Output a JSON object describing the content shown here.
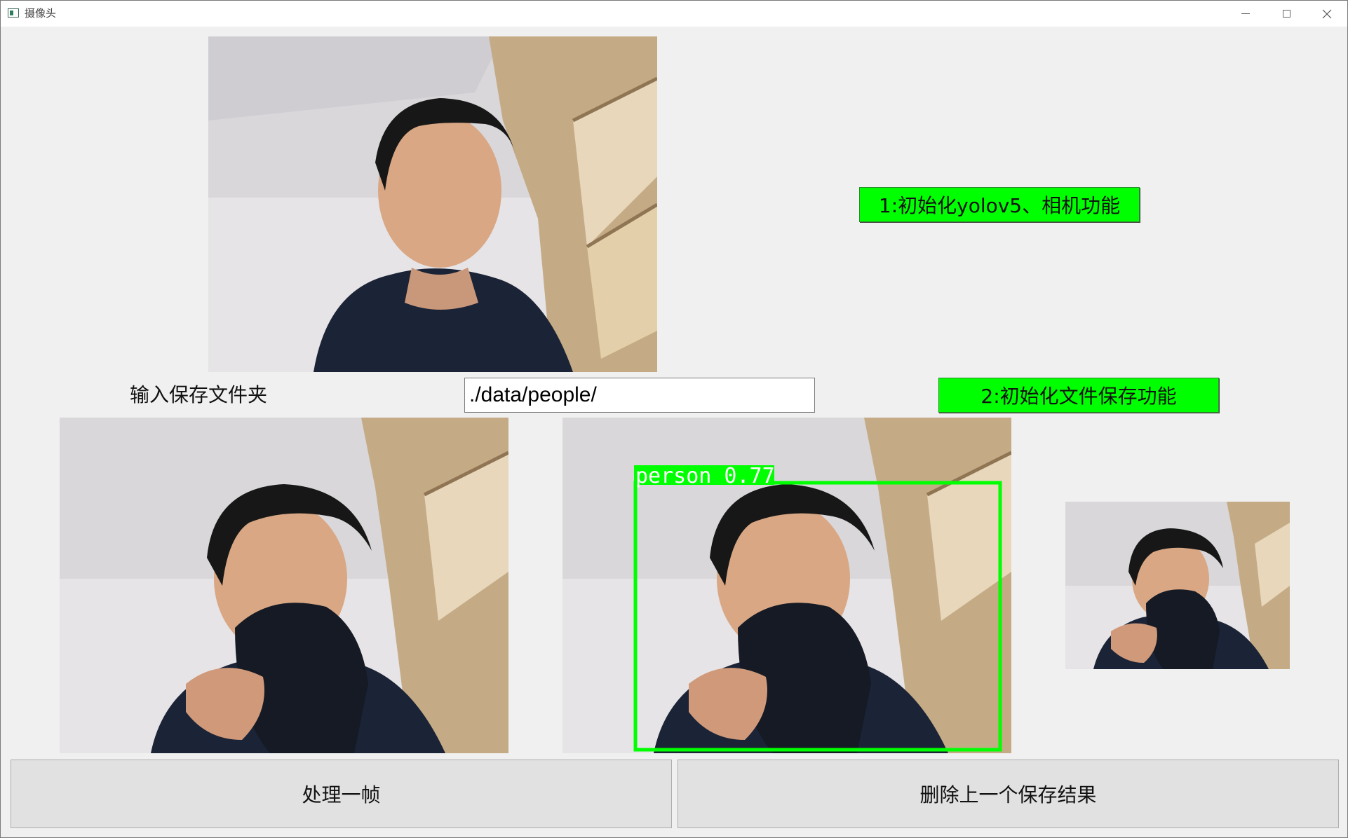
{
  "window": {
    "title": "摄像头"
  },
  "buttons": {
    "init_yolo": "1:初始化yolov5、相机功能",
    "init_save": "2:初始化文件保存功能",
    "process_frame": "处理一帧",
    "delete_last": "删除上一个保存结果"
  },
  "save_folder": {
    "label": "输入保存文件夹",
    "value": "./data/people/"
  },
  "detection": {
    "label": "person  0.77"
  },
  "colors": {
    "button_green": "#00ff00",
    "detection_box": "#00ff00",
    "window_bg": "#f0f0f0"
  },
  "icons": {
    "app": "window-app-icon",
    "minimize": "minimize-icon",
    "maximize": "maximize-icon",
    "close": "close-icon"
  }
}
